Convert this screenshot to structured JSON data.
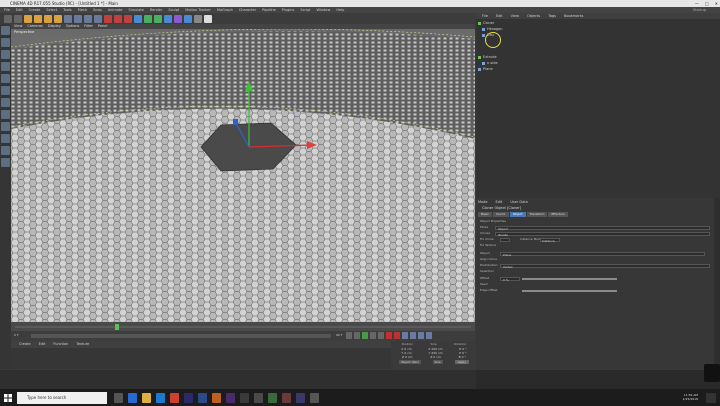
{
  "window": {
    "title": "CINEMA 4D R17.055 Studio (RC) - [Untitled 1 *] - Main",
    "minimize": "—",
    "maximize": "□",
    "close": "✕"
  },
  "menubar": [
    "File",
    "Edit",
    "Create",
    "Select",
    "Tools",
    "Mesh",
    "Snap",
    "Animate",
    "Simulate",
    "Render",
    "Sculpt",
    "Motion Tracker",
    "MoGraph",
    "Character",
    "Pipeline",
    "Plugins",
    "Script",
    "Window",
    "Help"
  ],
  "layout_label": "Startup",
  "viewport_menu": [
    "View",
    "Cameras",
    "Display",
    "Options",
    "Filter",
    "Panel"
  ],
  "viewport_label": "Perspective",
  "object_manager": {
    "menu": [
      "File",
      "Edit",
      "View",
      "Objects",
      "Tags",
      "Bookmarks"
    ],
    "objects": [
      {
        "name": "Cloner",
        "indent": 0,
        "color": "#6fbf5a"
      },
      {
        "name": "Hexagon",
        "indent": 1,
        "color": "#7aa0d8"
      },
      {
        "name": "Disc",
        "indent": 1,
        "color": "#7aa0d8"
      },
      {
        "name": "Extrude",
        "indent": 0,
        "color": "#6fbf5a"
      },
      {
        "name": "n-side",
        "indent": 1,
        "color": "#7aa0d8"
      },
      {
        "name": "Plane",
        "indent": 0,
        "color": "#7aa0d8"
      }
    ]
  },
  "attributes": {
    "menu": [
      "Mode",
      "Edit",
      "User Data"
    ],
    "title": "Cloner Object [Cloner]",
    "tabs": [
      "Basic",
      "Coord.",
      "Object",
      "Transform",
      "Effectors"
    ],
    "active_tab": "Object",
    "section": "Object Properties",
    "fields": [
      {
        "label": "Mode",
        "value": "Object"
      },
      {
        "label": "Clones",
        "value": "Iterate"
      },
      {
        "label": "Fix Clone",
        "value": "Fix Texture"
      },
      {
        "label": "Instance Mode",
        "value": "Instance"
      },
      {
        "label": "Object",
        "value": "Plane"
      },
      {
        "label": "Align Clone",
        "value": ""
      },
      {
        "label": "Distribution",
        "value": "Vertex"
      },
      {
        "label": "Selection",
        "value": ""
      },
      {
        "label": "Offset",
        "value": "0 %"
      },
      {
        "label": "Seed",
        "value": ""
      },
      {
        "label": "Edge Offset",
        "value": ""
      }
    ]
  },
  "material_menu": [
    "Create",
    "Edit",
    "Function",
    "Texture"
  ],
  "coords": {
    "headers": [
      "Position",
      "Size",
      "Rotation"
    ],
    "rows": [
      [
        "X 0 cm",
        "X 200 cm",
        "H 0 °"
      ],
      [
        "Y 0 cm",
        "Y 200 cm",
        "P 0 °"
      ],
      [
        "Z 0 cm",
        "Z 0 cm",
        "B 0 °"
      ]
    ],
    "mode": "Object (Rel)",
    "size_mode": "Size",
    "apply": "Apply"
  },
  "timeline": {
    "ticks": [
      "0",
      "5",
      "10",
      "15",
      "20",
      "25",
      "30",
      "35",
      "40",
      "45",
      "50",
      "55",
      "60",
      "65",
      "70",
      "75",
      "80",
      "85",
      "90"
    ],
    "current": "0 F",
    "end": "90 F"
  },
  "status_text": "Cloner Object [Cloner]",
  "taskbar": {
    "search_placeholder": "Type here to search",
    "time": "11:59 AM",
    "date": "1/25/2018"
  },
  "colors": {
    "accent": "#4a78b5",
    "titlebar": "#e6e6e6",
    "panel": "#333333"
  }
}
